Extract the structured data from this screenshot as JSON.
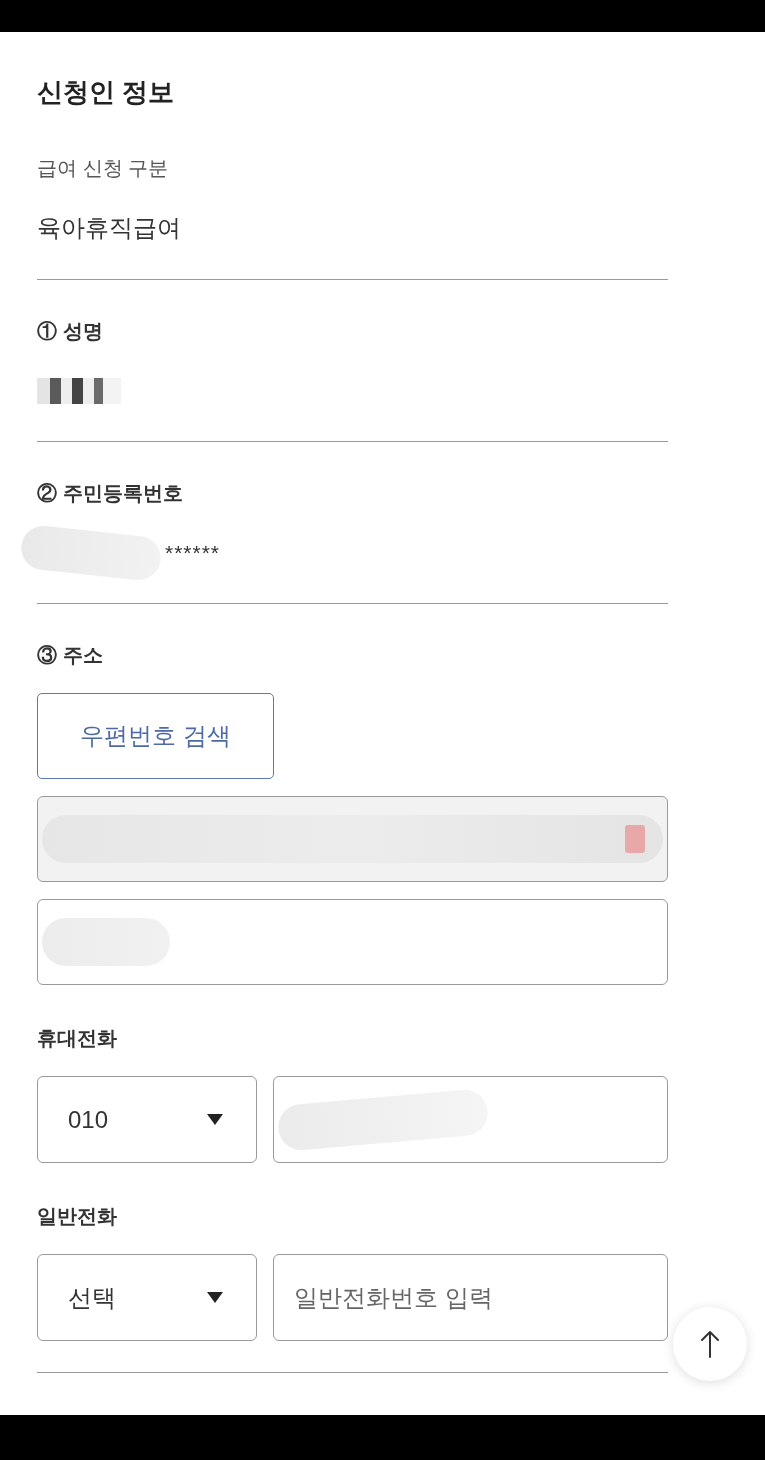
{
  "section": {
    "title": "신청인 정보"
  },
  "groups": [
    {
      "fields": [
        {
          "kind": "summary",
          "label": "급여 신청 구분",
          "value": "육아휴직급여"
        }
      ]
    },
    {
      "fields": [
        {
          "kind": "text",
          "label": "① 성명",
          "redacted": true
        }
      ]
    },
    {
      "fields": [
        {
          "kind": "text",
          "label": "② 주민등록번호",
          "value": "******",
          "redacted": true
        }
      ]
    },
    {
      "fields": [
        {
          "kind": "address",
          "label": "③ 주소",
          "button": "우편번호 검색",
          "lines": [
            {
              "readonly": true,
              "redacted": true
            },
            {
              "readonly": false,
              "redacted": true
            }
          ]
        },
        {
          "kind": "phone",
          "label": "휴대전화",
          "select": {
            "value": "010"
          },
          "input": {
            "redacted": true
          }
        },
        {
          "kind": "phone",
          "label": "일반전화",
          "select": {
            "value": "선택"
          },
          "input": {
            "placeholder": "일반전화번호 입력"
          }
        }
      ]
    }
  ]
}
